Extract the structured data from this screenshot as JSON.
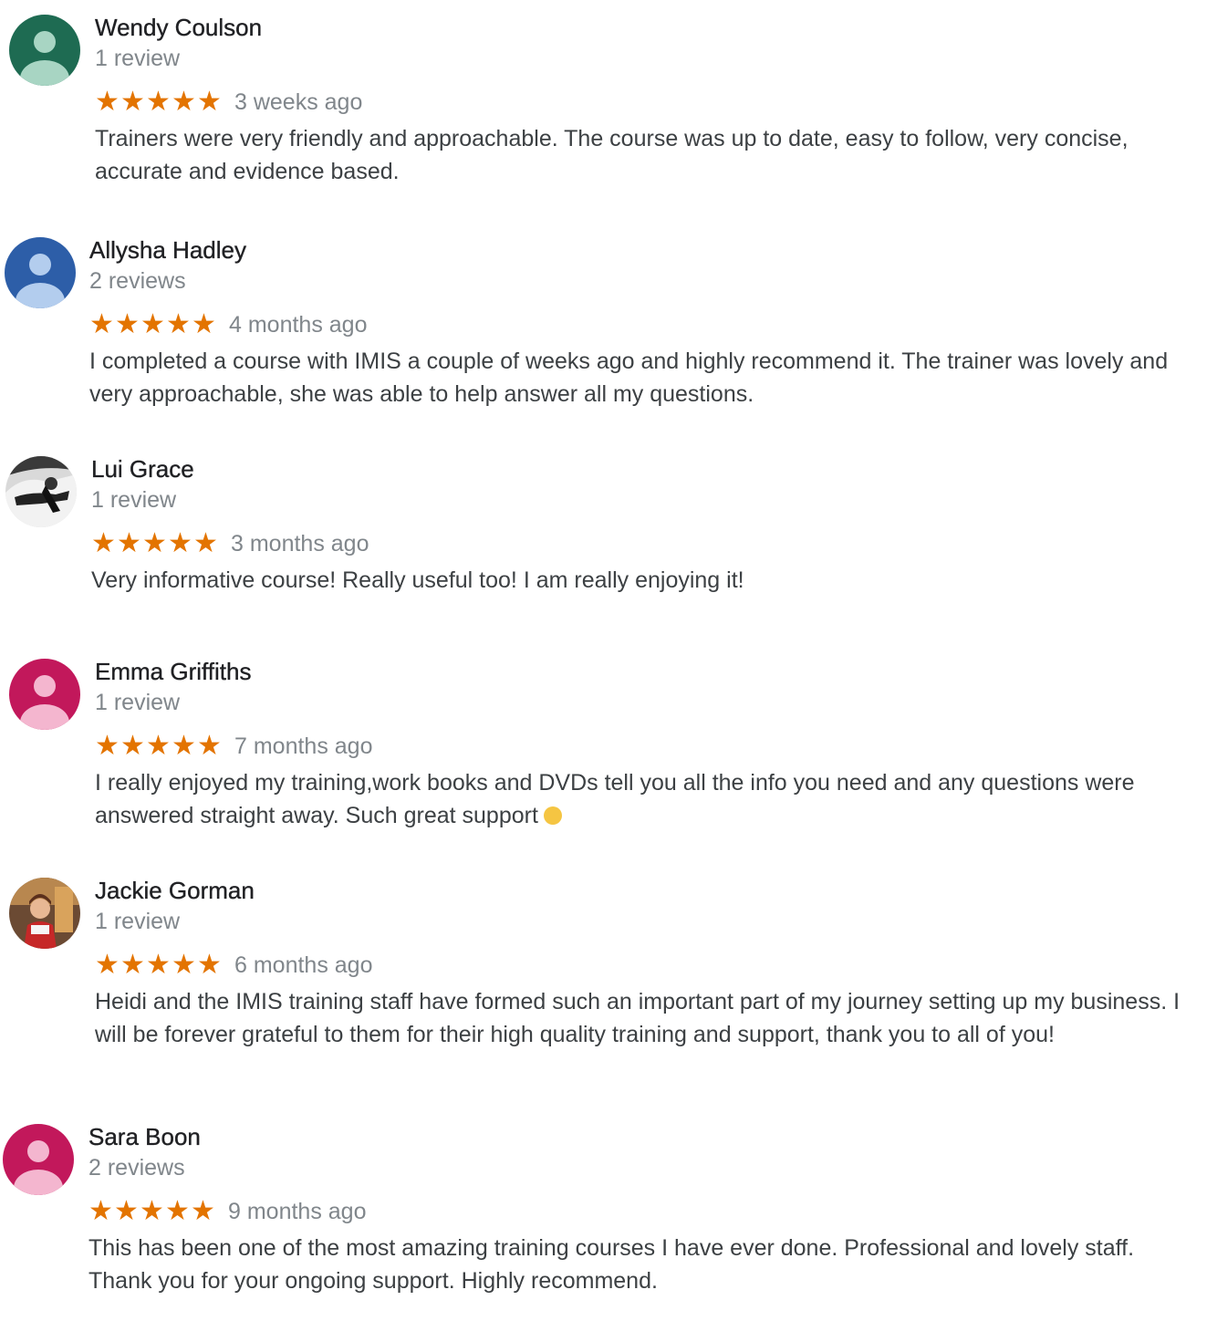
{
  "colors": {
    "star": "#e37400",
    "secondary_text": "#80868b",
    "body_text": "#3c4043"
  },
  "reviews": [
    {
      "name": "Wendy Coulson",
      "count": "1 review",
      "rating": 5,
      "date": "3 weeks ago",
      "text": "Trainers were very friendly and approachable.  The course was up to date, easy to follow, very concise, accurate and evidence based.",
      "avatar": "person-icon",
      "avatar_color": "#1e6b52"
    },
    {
      "name": "Allysha Hadley",
      "count": "2 reviews",
      "rating": 5,
      "date": "4 months ago",
      "text": "I completed a course with IMIS a couple of weeks ago and highly recommend it. The trainer was lovely and very approachable, she was able to help answer all my questions.",
      "avatar": "person-icon",
      "avatar_color": "#2d5ea8"
    },
    {
      "name": "Lui Grace",
      "count": "1 review",
      "rating": 5,
      "date": "3 months ago",
      "text": "Very informative course! Really useful too! I am really enjoying it!",
      "avatar": "photo",
      "avatar_color": "#555555"
    },
    {
      "name": "Emma Griffiths",
      "count": "1 review",
      "rating": 5,
      "date": "7 months ago",
      "text": "I really enjoyed my training,work books and DVDs tell you all the info you need and any questions were answered straight away. Such great support",
      "emoji": "laughing-face-emoji",
      "avatar": "person-icon",
      "avatar_color": "#c2185b"
    },
    {
      "name": "Jackie Gorman",
      "count": "1 review",
      "rating": 5,
      "date": "6 months ago",
      "text": "Heidi and the IMIS training staff have formed such an important part of my journey setting up my business. I will be forever grateful to them for their high quality training and support, thank you to all of you!",
      "avatar": "photo",
      "avatar_color": "#8a5a3a"
    },
    {
      "name": "Sara Boon",
      "count": "2 reviews",
      "rating": 5,
      "date": "9 months ago",
      "text": "This has been one of the most amazing training courses I have ever done. Professional and lovely staff. Thank you for your ongoing support. Highly recommend.",
      "avatar": "person-icon",
      "avatar_color": "#c2185b"
    }
  ]
}
